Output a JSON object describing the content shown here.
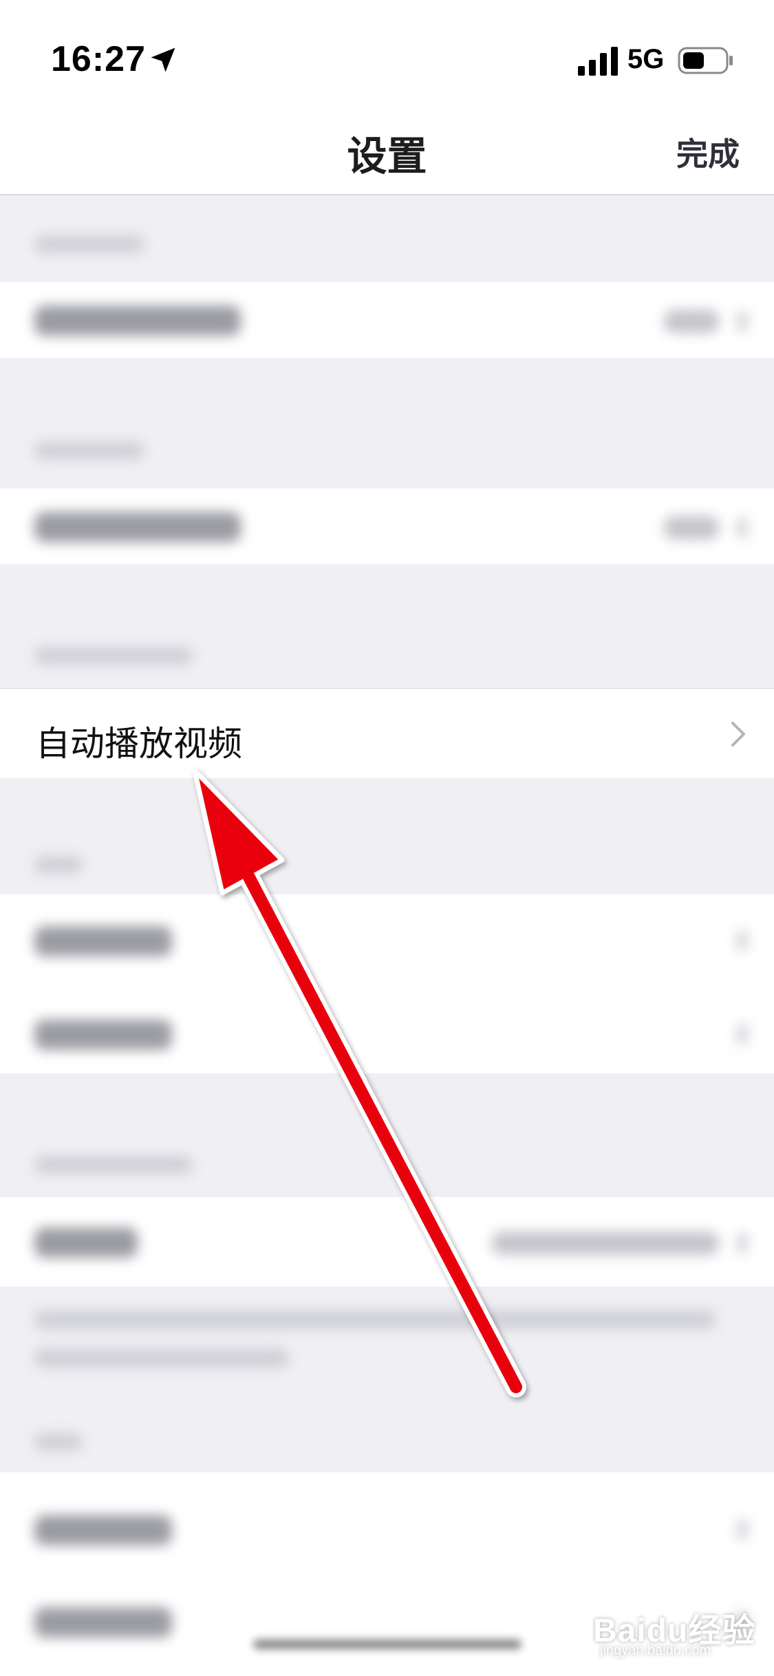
{
  "status_bar": {
    "time": "16:27",
    "network": "5G",
    "icons": [
      "location-arrow-icon",
      "signal-bars-icon",
      "battery-icon"
    ]
  },
  "nav": {
    "title": "设置",
    "done_label": "完成"
  },
  "focused_row": {
    "label": "自动播放视频",
    "icon": "chevron-right-icon"
  },
  "annotation": {
    "type": "red-arrow",
    "color": "#e8000f"
  },
  "watermark": {
    "brand": "Baidu经验",
    "url": "jingyan.baidu.com"
  }
}
